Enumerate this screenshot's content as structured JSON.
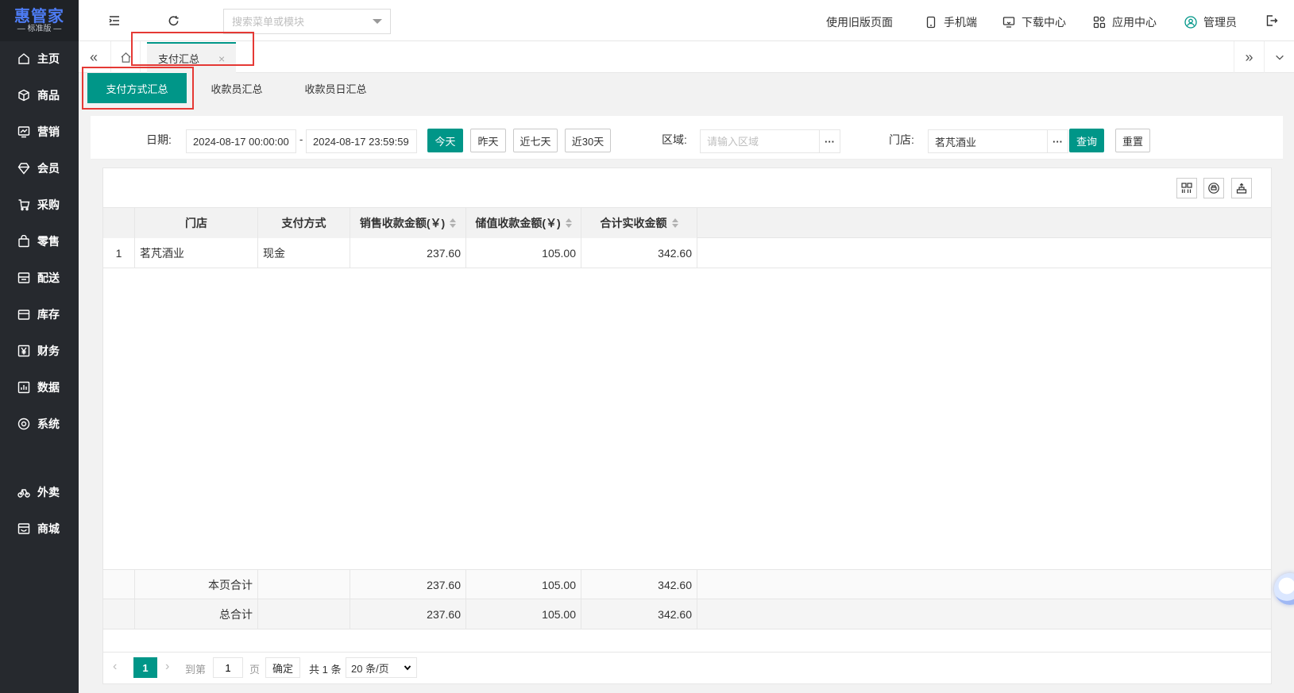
{
  "sidebar": {
    "logo_name": "惠管家",
    "logo_edition": "— 标准版 —",
    "items": [
      {
        "label": "主页",
        "icon": "home-icon"
      },
      {
        "label": "商品",
        "icon": "cube-icon"
      },
      {
        "label": "营销",
        "icon": "chart-icon"
      },
      {
        "label": "会员",
        "icon": "diamond-icon"
      },
      {
        "label": "采购",
        "icon": "cart-icon"
      },
      {
        "label": "零售",
        "icon": "bag-icon"
      },
      {
        "label": "配送",
        "icon": "delivery-icon"
      },
      {
        "label": "库存",
        "icon": "box-icon"
      },
      {
        "label": "财务",
        "icon": "yen-icon"
      },
      {
        "label": "数据",
        "icon": "bar-chart-icon"
      },
      {
        "label": "系统",
        "icon": "gear-icon"
      },
      {
        "label": "外卖",
        "icon": "bike-icon"
      },
      {
        "label": "商城",
        "icon": "store-icon"
      }
    ]
  },
  "topbar": {
    "search_placeholder": "搜索菜单或模块",
    "old_page": "使用旧版页面",
    "mobile": "手机端",
    "download": "下载中心",
    "apps": "应用中心",
    "user": "管理员"
  },
  "tabs": {
    "open_tab": "支付汇总",
    "close_glyph": "×"
  },
  "subtabs": [
    "支付方式汇总",
    "收款员汇总",
    "收款员日汇总"
  ],
  "filters": {
    "date_label": "日期:",
    "date_start": "2024-08-17 00:00:00",
    "date_sep": "-",
    "date_end": "2024-08-17 23:59:59",
    "quick": [
      "今天",
      "昨天",
      "近七天",
      "近30天"
    ],
    "region_label": "区域:",
    "region_placeholder": "请输入区域",
    "store_label": "门店:",
    "store_value": "茗芃酒业",
    "query": "查询",
    "reset": "重置",
    "more": "···"
  },
  "table": {
    "columns": [
      "门店",
      "支付方式",
      "销售收款金额(￥)",
      "储值收款金额(￥)",
      "合计实收金额"
    ],
    "rows": [
      {
        "index": "1",
        "store": "茗芃酒业",
        "method": "现金",
        "sales": "237.60",
        "stored": "105.00",
        "total": "342.60"
      }
    ],
    "page_total": {
      "label": "本页合计",
      "sales": "237.60",
      "stored": "105.00",
      "total": "342.60"
    },
    "grand_total": {
      "label": "总合计",
      "sales": "237.60",
      "stored": "105.00",
      "total": "342.60"
    }
  },
  "pager": {
    "current": "1",
    "goto_label": "到第",
    "goto_value": "1",
    "page_unit": "页",
    "confirm": "确定",
    "count": "共 1 条",
    "page_size": "20 条/页"
  },
  "colors": {
    "primary": "#009688",
    "sidebar": "#26292e",
    "highlight": "#e53935"
  }
}
